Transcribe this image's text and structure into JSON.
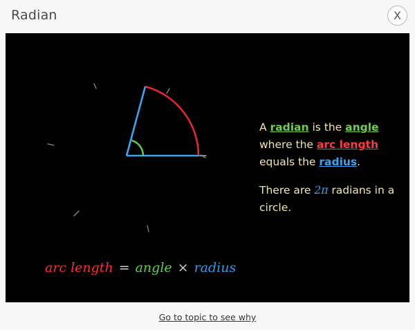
{
  "window": {
    "title": "Radian",
    "close_label": "X"
  },
  "explanation": {
    "part1": "A ",
    "radian": "radian",
    "part2": " is the ",
    "angle": "angle",
    "part3": " where the ",
    "arc_length": "arc length",
    "part4": " equals the ",
    "radius": "radius",
    "part5": ".",
    "line2_pre": "There are ",
    "two_pi": "2π",
    "line2_post": " radians in a circle."
  },
  "formula": {
    "arc_length": "arc length",
    "equals": "=",
    "angle": "angle",
    "times": "×",
    "radius": "radius"
  },
  "footer": {
    "link": "Go to topic to see why"
  },
  "colors": {
    "background": "#000000",
    "arc": "#e8272b",
    "radius": "#3aa4f2",
    "angle": "#5fd14a",
    "text": "#f2e7a7"
  }
}
